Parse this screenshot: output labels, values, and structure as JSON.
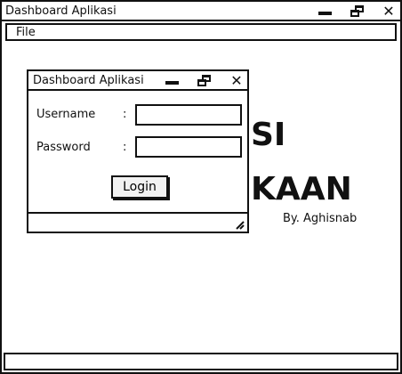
{
  "main_window": {
    "title": "Dashboard Aplikasi",
    "menu": [
      "File"
    ],
    "background_text": {
      "line1": "SI",
      "line2": "KAAN",
      "credit": "By. Aghisnab"
    }
  },
  "login_dialog": {
    "title": "Dashboard Aplikasi",
    "username_label": "Username",
    "password_label": "Password",
    "separator": ":",
    "username_value": "",
    "password_value": "",
    "login_button": "Login"
  },
  "icons": {
    "minimize": "minimize-icon",
    "restore": "restore-icon",
    "close": "close-icon",
    "resize": "resize-grip-icon"
  },
  "glyphs": {
    "close": "✕"
  }
}
